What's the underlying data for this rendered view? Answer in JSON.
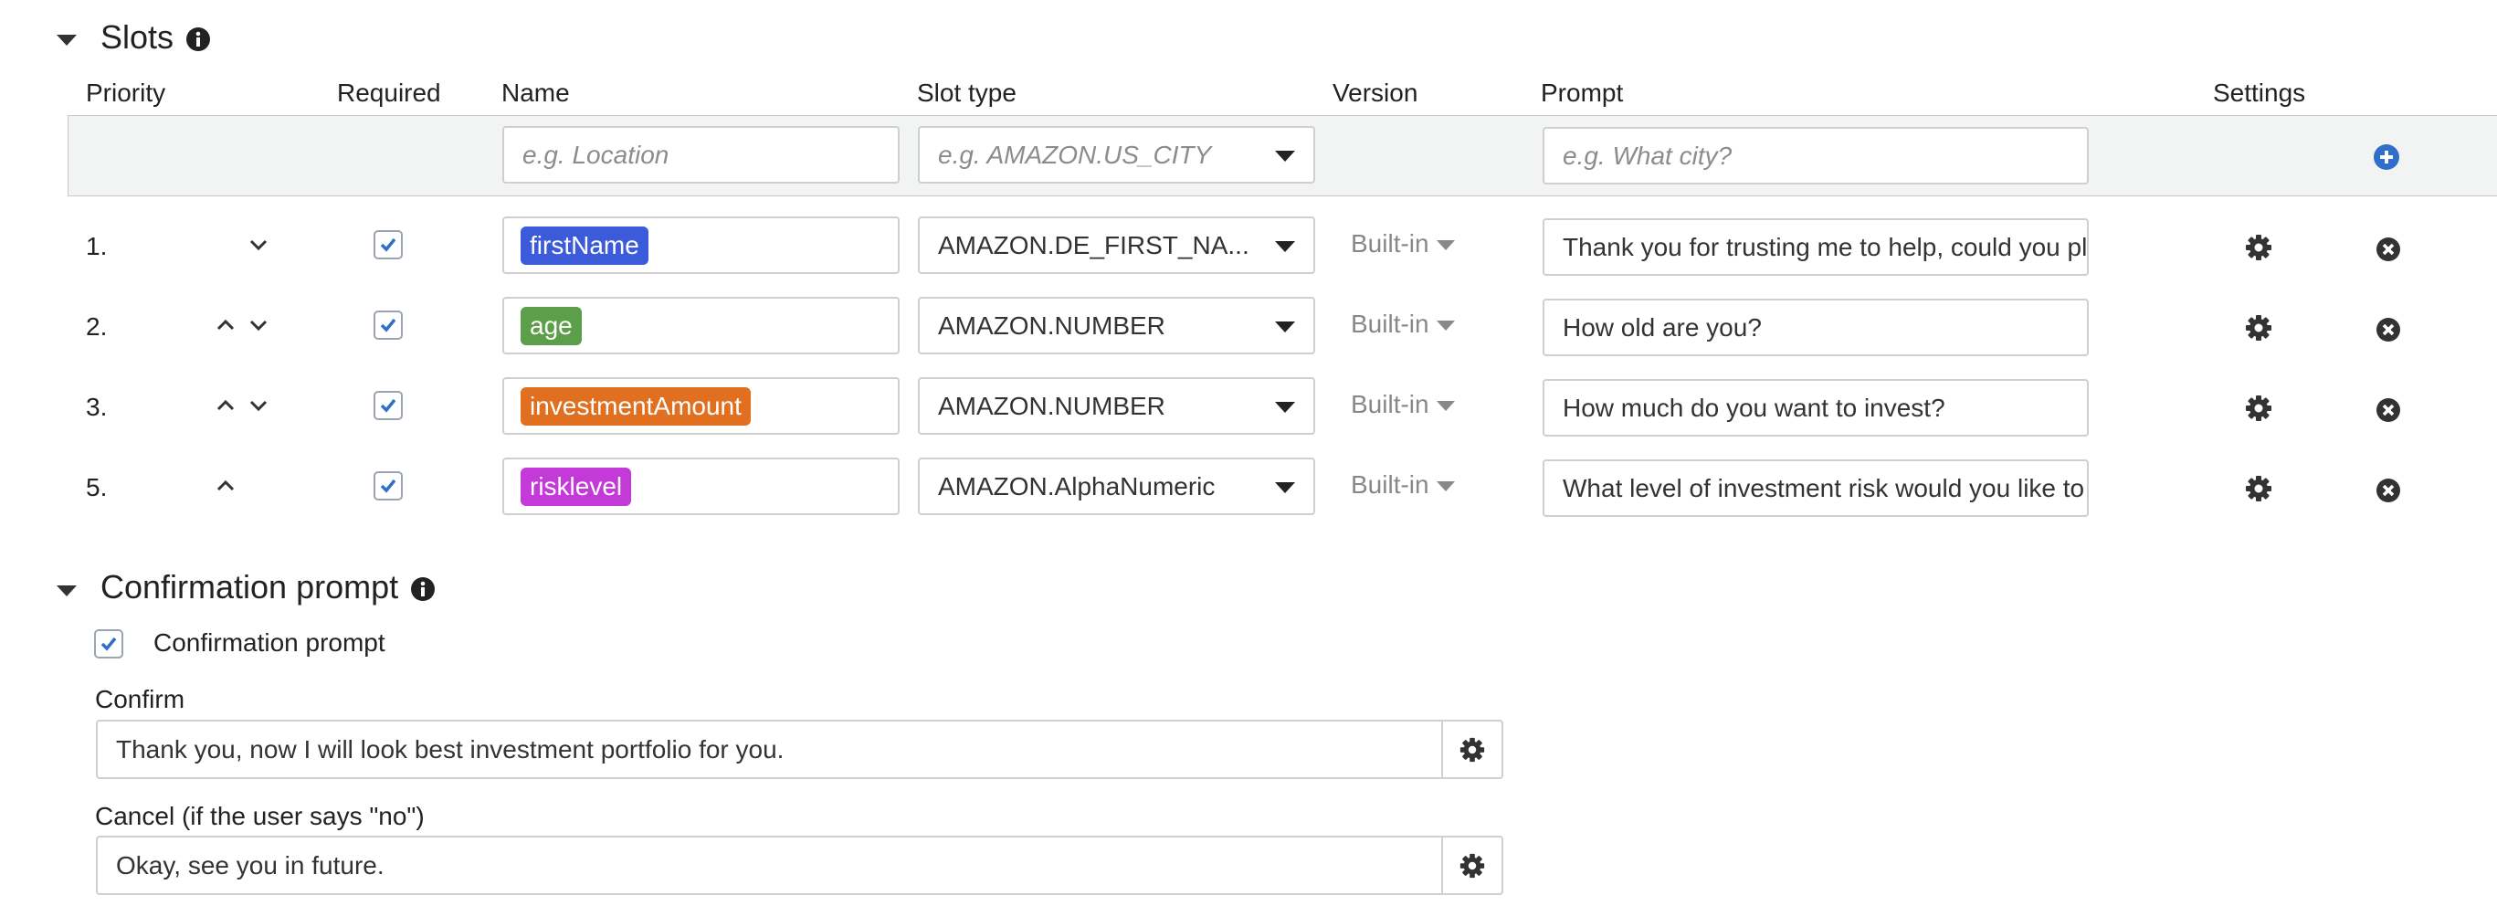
{
  "slots_section": {
    "title": "Slots"
  },
  "columns": {
    "priority": "Priority",
    "required": "Required",
    "name": "Name",
    "slot_type": "Slot type",
    "version": "Version",
    "prompt": "Prompt",
    "settings": "Settings"
  },
  "new_slot": {
    "name_placeholder": "e.g. Location",
    "type_placeholder": "e.g. AMAZON.US_CITY",
    "prompt_placeholder": "e.g. What city?"
  },
  "slots": [
    {
      "priority": "1.",
      "required": true,
      "name": "firstName",
      "tag_color": "#3b5bdb",
      "slot_type": "AMAZON.DE_FIRST_NA...",
      "version": "Built-in",
      "prompt": "Thank you for trusting me to help, could you pl",
      "move_up": false,
      "move_down": true
    },
    {
      "priority": "2.",
      "required": true,
      "name": "age",
      "tag_color": "#5c9e4a",
      "slot_type": "AMAZON.NUMBER",
      "version": "Built-in",
      "prompt": "How old are you?",
      "move_up": true,
      "move_down": true
    },
    {
      "priority": "3.",
      "required": true,
      "name": "investmentAmount",
      "tag_color": "#e07020",
      "slot_type": "AMAZON.NUMBER",
      "version": "Built-in",
      "prompt": "How much do you want to invest?",
      "move_up": true,
      "move_down": true
    },
    {
      "priority": "5.",
      "required": true,
      "name": "risklevel",
      "tag_color": "#c43ad8",
      "slot_type": "AMAZON.AlphaNumeric",
      "version": "Built-in",
      "prompt": "What level of investment risk would you like to",
      "move_up": true,
      "move_down": false
    }
  ],
  "confirmation_section": {
    "title": "Confirmation prompt",
    "checkbox_label": "Confirmation prompt",
    "checked": true,
    "confirm_label": "Confirm",
    "confirm_value": "Thank you, now I will look best investment portfolio for you.",
    "cancel_label": "Cancel (if the user says \"no\")",
    "cancel_value": "Okay, see you in future."
  },
  "colors": {
    "accent": "#2f6ec9",
    "tag_firstName": "#3b5bdb",
    "tag_age": "#5c9e4a",
    "tag_investmentAmount": "#e07020",
    "tag_risklevel": "#c43ad8"
  },
  "icons": [
    "caret-down-icon",
    "info-icon",
    "chevron-up-icon",
    "chevron-down-icon",
    "checkbox-icon",
    "gear-icon",
    "remove-icon",
    "add-icon"
  ]
}
